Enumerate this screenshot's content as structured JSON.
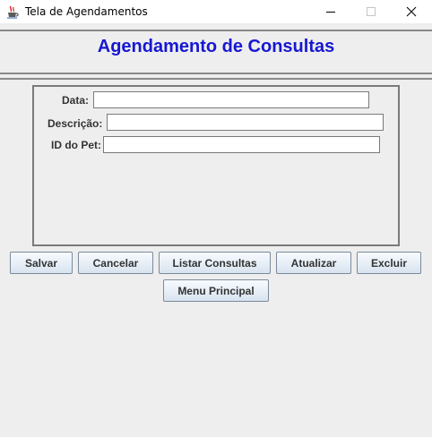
{
  "window": {
    "title": "Tela de Agendamentos",
    "minimize_glyph": "—",
    "maximize_glyph": "☐",
    "close_glyph": "✕"
  },
  "heading": "Agendamento de Consultas",
  "form": {
    "date_label": "Data:",
    "date_value": "",
    "description_label": "Descrição:",
    "description_value": "",
    "pet_id_label": "ID do Pet:",
    "pet_id_value": ""
  },
  "buttons": {
    "save": "Salvar",
    "cancel": "Cancelar",
    "list": "Listar Consultas",
    "update": "Atualizar",
    "delete": "Excluir",
    "main_menu": "Menu Principal"
  },
  "colors": {
    "heading": "#1717d3",
    "background": "#eeeeee"
  },
  "icons": {
    "app": "java-cup-icon",
    "minimize": "minimize-icon",
    "maximize": "maximize-icon",
    "close": "close-icon"
  }
}
